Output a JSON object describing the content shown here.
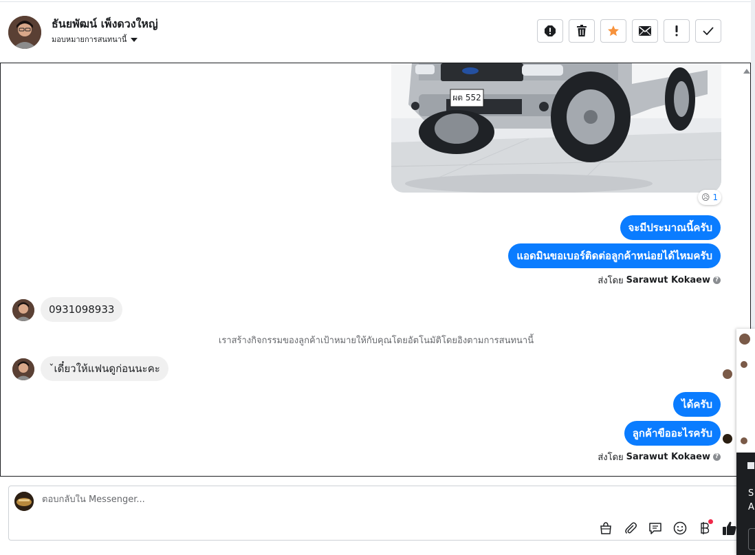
{
  "header": {
    "contact_name": "ธันยพัฒน์ เพ็งดวงใหญ่",
    "assign_label": "มอบหมายการสนทนานี้"
  },
  "toolbar": {
    "buttons": [
      {
        "icon": "spam-alert-icon"
      },
      {
        "icon": "trash-icon"
      },
      {
        "icon": "star-icon",
        "color": "#f7923b"
      },
      {
        "icon": "mail-icon"
      },
      {
        "icon": "follow-up-icon"
      },
      {
        "icon": "check-icon"
      }
    ]
  },
  "chat": {
    "photo": {
      "plate_text": "ผต 552"
    },
    "reaction": {
      "emoji": "😥",
      "count": "1"
    },
    "messages_out_1": [
      "จะมีประมาณนี้ครับ",
      "แอดมินขอเบอร์ติดต่อลูกค้าหน่อยได้ไหมครับ"
    ],
    "sent_by_1": {
      "prefix": "ส่งโดย",
      "name": "Sarawut Kokaew"
    },
    "message_in_1": "0931098933",
    "system_message": "เราสร้างกิจกรรมของลูกค้าเป้าหมายให้กับคุณโดยอัตโนมัติโดยอิงตามการสนทนานี้",
    "message_in_2": "ˇเดี๋ยวให้แฟนดูก่อนนะคะ",
    "messages_out_2": [
      "ได้ครับ",
      "ลูกค้าขืออะไรครับ"
    ],
    "sent_by_2": {
      "prefix": "ส่งโดย",
      "name": "Sarawut Kokaew"
    }
  },
  "composer": {
    "placeholder": "ตอบกลับใน Messenger...",
    "icons": [
      "shop-icon",
      "attachment-icon",
      "saved-reply-icon",
      "emoji-icon",
      "payment-icon",
      "like-icon"
    ],
    "accent": "#0a7cff"
  },
  "right_panel": {
    "text_1": "S",
    "text_2": "A"
  }
}
